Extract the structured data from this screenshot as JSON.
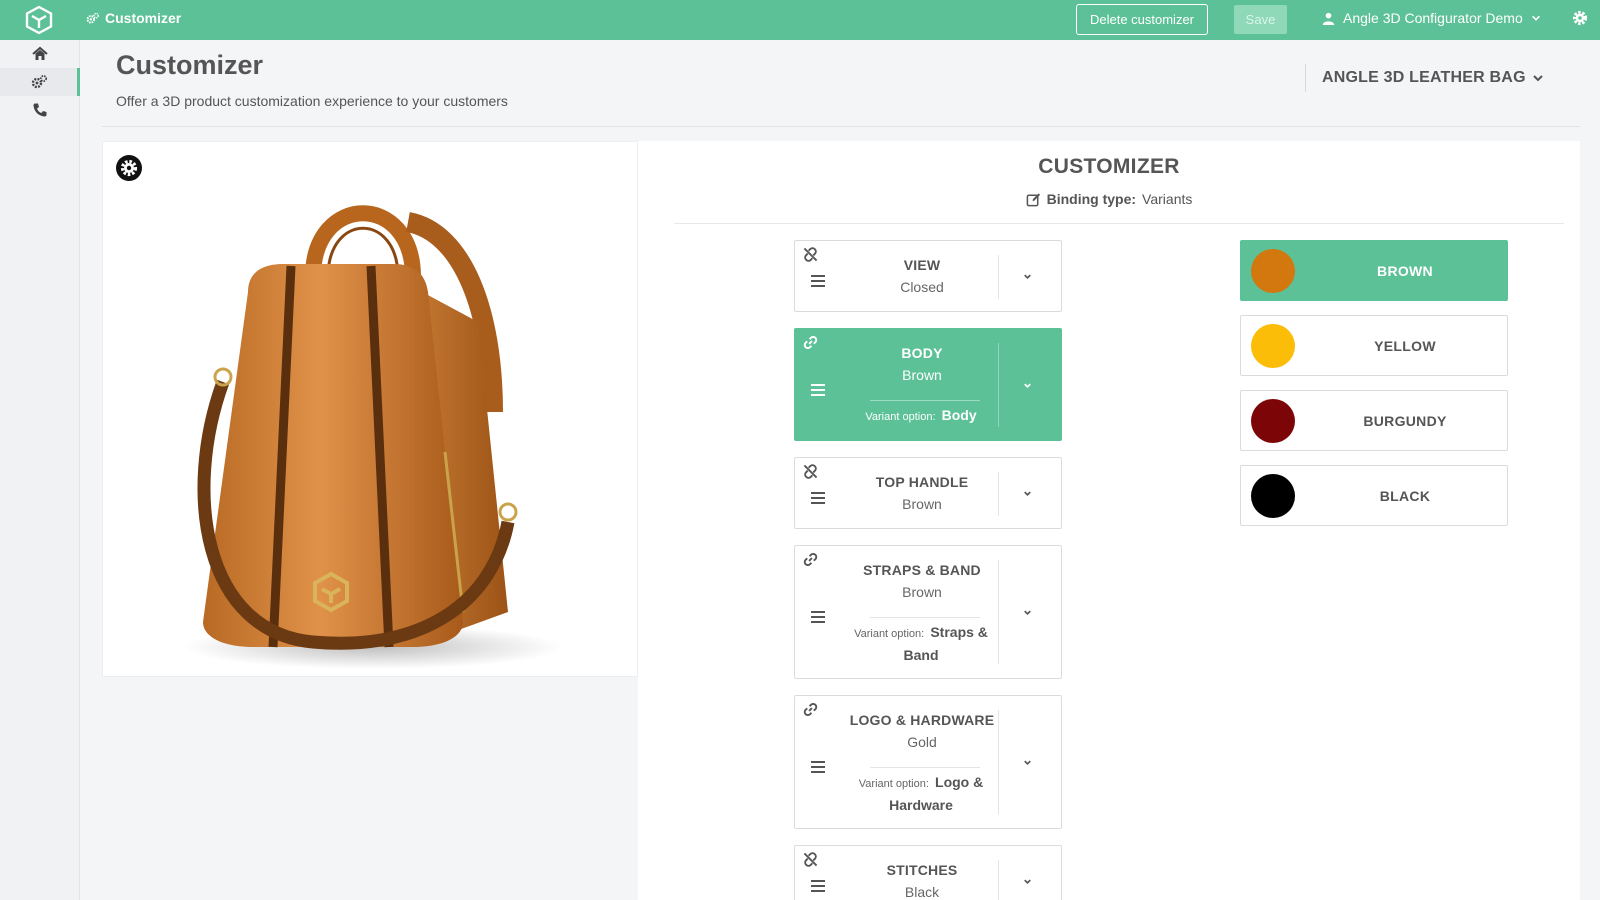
{
  "topbar": {
    "section": "Customizer",
    "delete_label": "Delete customizer",
    "save_label": "Save",
    "account": "Angle 3D Configurator Demo"
  },
  "header": {
    "title": "Customizer",
    "subtitle": "Offer a 3D product customization experience to your customers",
    "product": "ANGLE 3D LEATHER BAG"
  },
  "panel": {
    "title": "CUSTOMIZER",
    "binding_label": "Binding type:",
    "binding_value": "Variants"
  },
  "components": [
    {
      "name": "VIEW",
      "value": "Closed",
      "linked": false,
      "active": false
    },
    {
      "name": "BODY",
      "value": "Brown",
      "linked": true,
      "active": true,
      "variant_label": "Variant option:",
      "variant": "Body"
    },
    {
      "name": "TOP HANDLE",
      "value": "Brown",
      "linked": false,
      "active": false
    },
    {
      "name": "STRAPS & BAND",
      "value": "Brown",
      "linked": true,
      "active": false,
      "variant_label": "Variant option:",
      "variant": "Straps & Band"
    },
    {
      "name": "LOGO & HARDWARE",
      "value": "Gold",
      "linked": true,
      "active": false,
      "variant_label": "Variant option:",
      "variant": "Logo & Hardware"
    },
    {
      "name": "STITCHES",
      "value": "Black",
      "linked": false,
      "active": false
    }
  ],
  "swatches": [
    {
      "name": "BROWN",
      "color": "#d2780e",
      "active": true
    },
    {
      "name": "YELLOW",
      "color": "#fbbd08",
      "active": false
    },
    {
      "name": "BURGUNDY",
      "color": "#7c0607",
      "active": false
    },
    {
      "name": "BLACK",
      "color": "#000000",
      "active": false
    }
  ],
  "colors": {
    "accent": "#5cc196",
    "bag_leather": "#d98a3d",
    "bag_dark": "#7a4418"
  },
  "icons": {
    "logo": "hexagon-cube-logo",
    "section": "cogs-icon",
    "account": "user-icon",
    "settings": "gear-icon",
    "home": "home-icon",
    "phone": "phone-icon",
    "edit": "edit-icon",
    "link": "link-icon",
    "unlink": "unlink-icon",
    "drag": "hamburger-icon",
    "expand": "chevron-down-icon"
  }
}
